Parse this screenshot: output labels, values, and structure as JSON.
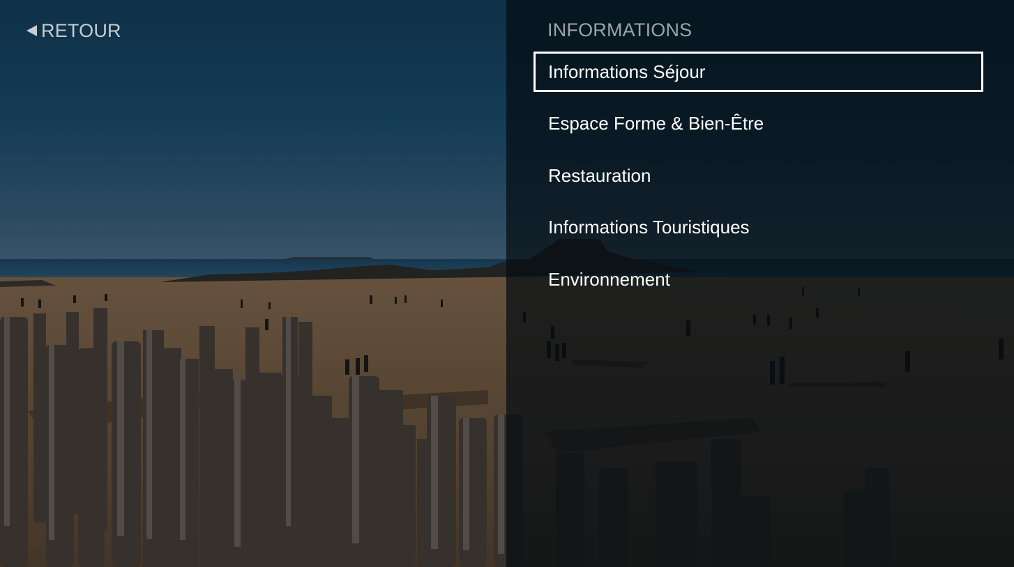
{
  "nav": {
    "back_label": "RETOUR",
    "back_icon": "left-triangle-icon"
  },
  "panel": {
    "title": "INFORMATIONS",
    "items": [
      {
        "label": "Informations Séjour",
        "selected": true
      },
      {
        "label": "Espace Forme & Bien-Être",
        "selected": false
      },
      {
        "label": "Restauration",
        "selected": false
      },
      {
        "label": "Informations Touristiques",
        "selected": false
      },
      {
        "label": "Environnement",
        "selected": false
      }
    ]
  },
  "colors": {
    "text": "#ffffff",
    "muted": "#9da3a9",
    "selection_border": "#ffffff"
  }
}
